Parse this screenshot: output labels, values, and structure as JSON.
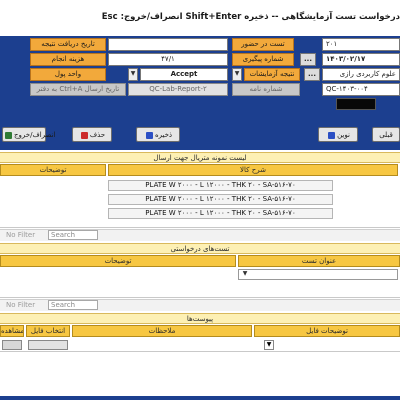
{
  "title_bar": {
    "text": "درخواست تست آزمایشگاهی  --  ذخیره Shift+Enter  انصراف/خروج: Esc"
  },
  "header": {
    "labels": {
      "test_date": "تاریخ دریافت نتیجه",
      "cost": "هزینه انجام",
      "unit": "واحد پول",
      "send_date": "تاریخ ارسال Ctrl+A به دفتر",
      "test_in_person": "تست در حضور",
      "tracking_no": "شماره پیگیری",
      "test_result": "نتیجه آزمایشات",
      "letter_no": "شماره نامه"
    },
    "values": {
      "num_field": "۴۷/۱",
      "accept": "Accept",
      "report_code": "QC-Lab-Report-۲",
      "number_top": "۲۰۱",
      "date": "۱۴۰۳/۰۲/۱۷",
      "lab_name": "علوم کاربردی رازی",
      "code": "QC-۱۴۰۳-۰۰۴"
    },
    "buttons": {
      "dots": "...",
      "dropdown": "▼"
    }
  },
  "toolbar": {
    "exit": "انصراف/خروج",
    "delete": "حذف",
    "save": "ذخیره",
    "new": "نوین",
    "prev": "قبلی"
  },
  "materials": {
    "band_title": "لیست نمونه متریال جهت ارسال",
    "col_description": "توضیحات",
    "col_item": "شرح کالا",
    "rows": [
      "PLATE W ۲۰۰۰ - L ۱۲۰۰۰ - THK ۲۰ - SA-۵۱۶-۷۰",
      "PLATE W ۲۰۰۰ - L ۱۲۰۰۰ - THK ۲۰ - SA-۵۱۶-۷۰",
      "PLATE W ۲۰۰۰ - L ۱۲۰۰۰ - THK ۲۰ - SA-۵۱۶-۷۰"
    ],
    "filter_text": "No Filter",
    "search_text": "Search"
  },
  "tests": {
    "band_title": "تست‌های درخواستی",
    "col_description": "توضیحات",
    "col_test": "عنوان تست",
    "filter_text": "No Filter",
    "search_text": "Search"
  },
  "attachments": {
    "band_title": "پیوست‌ها",
    "col_file_desc": "توضیحات فایل",
    "col_notes": "ملاحظات",
    "col_select_file": "انتخاب فایل",
    "col_view": "مشاهده"
  },
  "colors": {
    "header_blue": "#1c3f8f",
    "label_orange": "#f2a93b",
    "column_yellow": "#f7c742",
    "band_yellow": "#fdf0b4"
  }
}
